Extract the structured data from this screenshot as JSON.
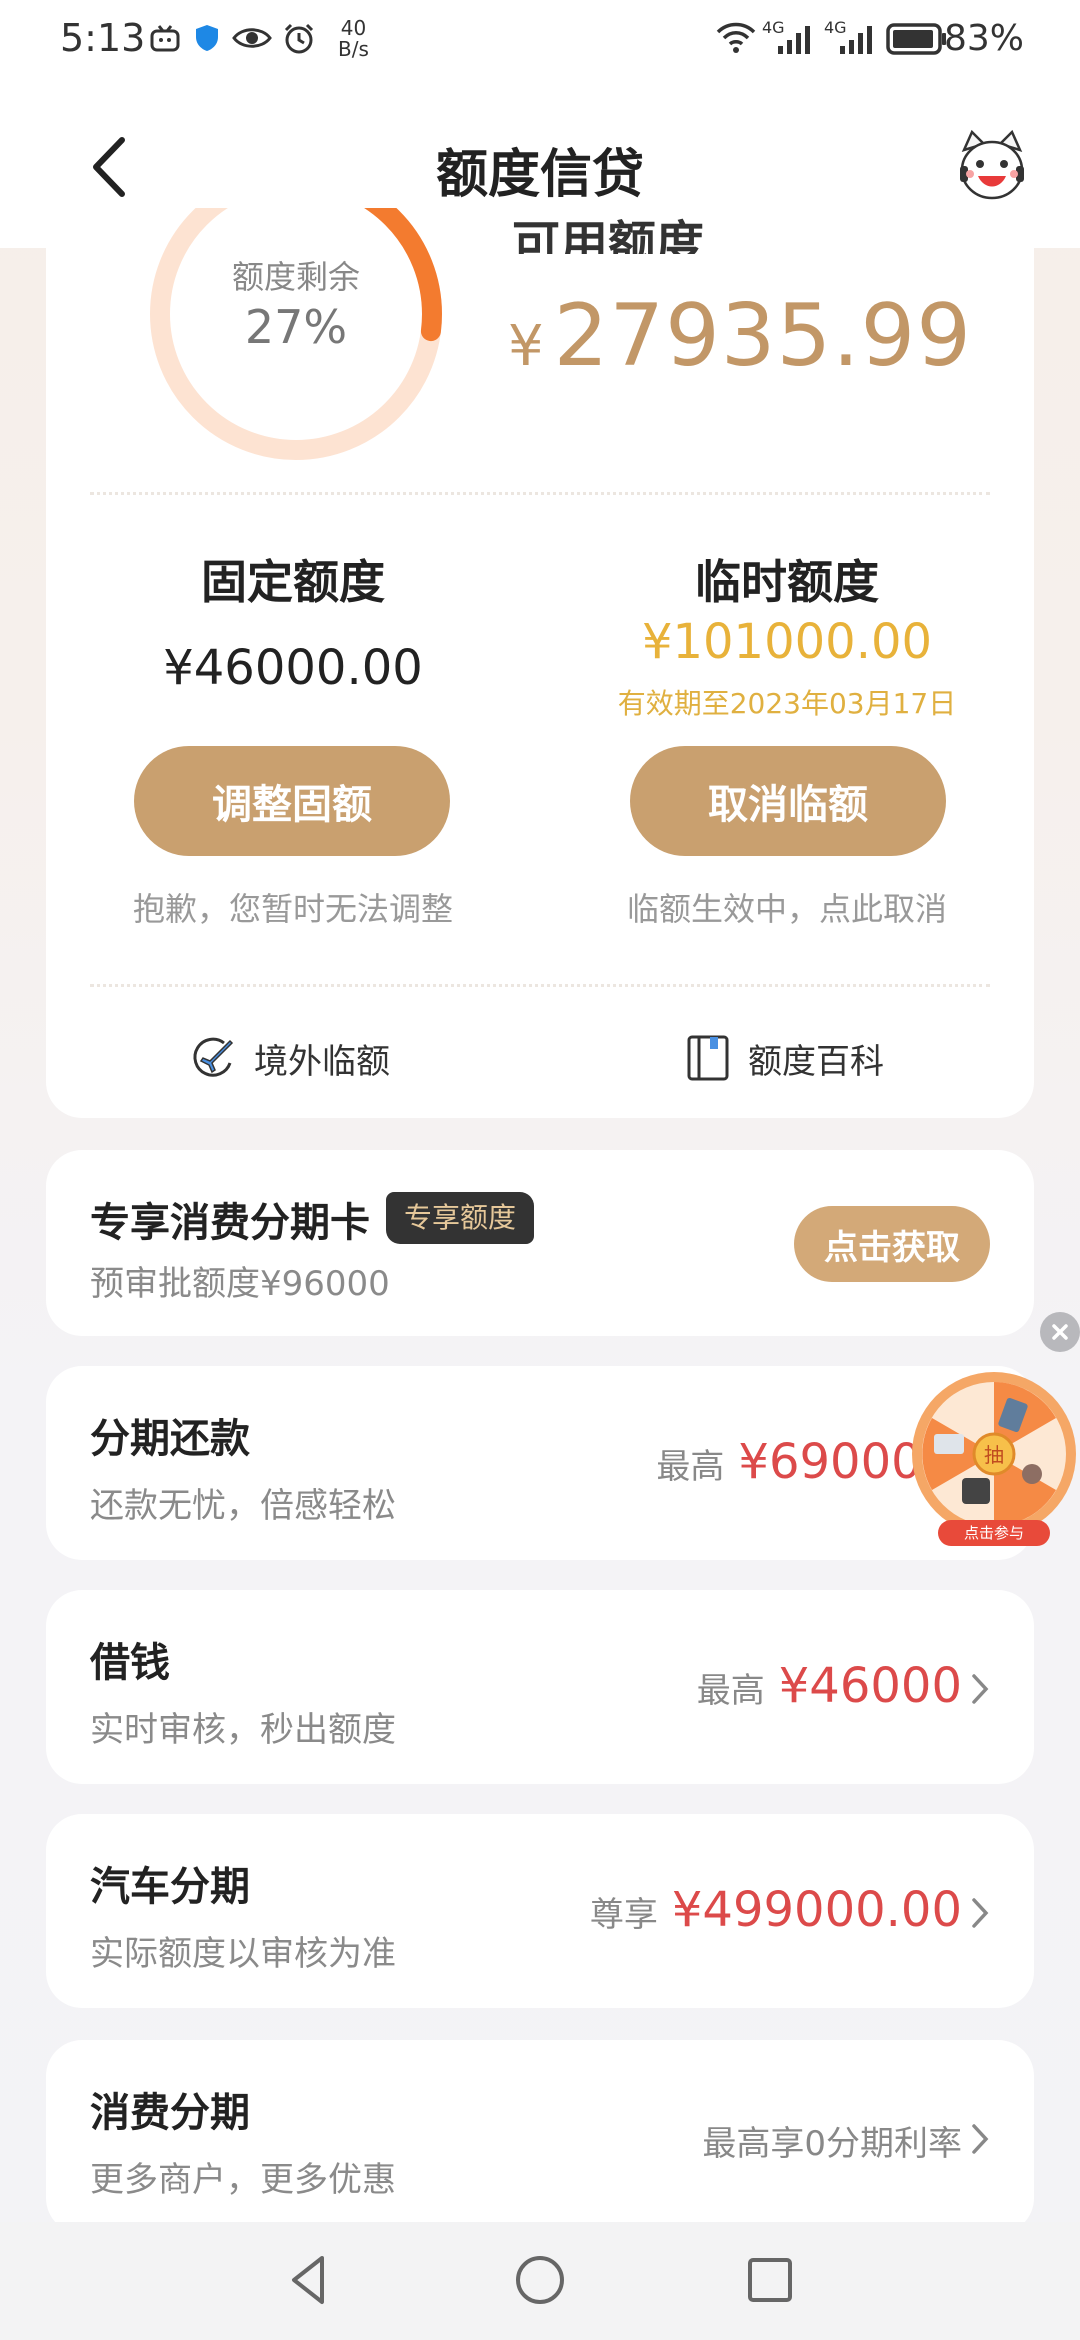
{
  "status_bar": {
    "time": "5:13",
    "net_speed_value": "40",
    "net_speed_unit": "B/s",
    "signal_1": "4G",
    "signal_2": "4G",
    "battery_percent": "83%"
  },
  "header": {
    "title": "额度信贷"
  },
  "credit": {
    "ring_label": "额度剩余",
    "ring_percent": "27%",
    "remaining_fraction": 0.27,
    "available_label": "可用额度",
    "available_currency": "¥",
    "available_amount": "27935.99",
    "fixed": {
      "title": "固定额度",
      "amount": "¥46000.00",
      "button": "调整固额",
      "note": "抱歉，您暂时无法调整"
    },
    "temp": {
      "title": "临时额度",
      "amount": "¥101000.00",
      "expiry": "有效期至2023年03月17日",
      "button": "取消临额",
      "note": "临额生效中，点此取消"
    },
    "links": {
      "overseas": "境外临额",
      "wiki": "额度百科"
    }
  },
  "promo": {
    "title": "专享消费分期卡",
    "badge": "专享额度",
    "subtitle": "预审批额度¥96000",
    "button": "点击获取"
  },
  "products": [
    {
      "title": "分期还款",
      "subtitle": "还款无忧，倍感轻松",
      "prefix": "最高",
      "amount": "¥69000.00"
    },
    {
      "title": "借钱",
      "subtitle": "实时审核，秒出额度",
      "prefix": "最高",
      "amount": "¥46000"
    },
    {
      "title": "汽车分期",
      "subtitle": "实际额度以审核为准",
      "prefix": "尊享",
      "amount": "¥499000.00"
    },
    {
      "title": "消费分期",
      "subtitle": "更多商户，更多优惠",
      "text": "最高享0分期利率"
    }
  ],
  "floating": {
    "center_label": "抽",
    "cta": "点击参与"
  },
  "colors": {
    "gold": "#c29767",
    "button_gold": "#c9a06f",
    "temp_yellow": "#e8b23a",
    "amount_red": "#dc4a4a",
    "ring_orange": "#f37b2f",
    "ring_track": "#fde3d2"
  }
}
